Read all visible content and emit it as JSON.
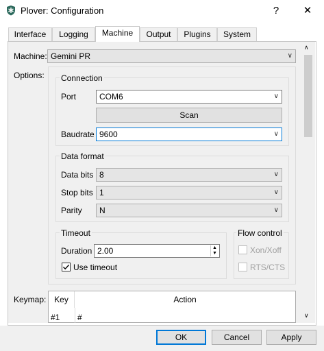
{
  "window": {
    "title": "Plover: Configuration",
    "help_label": "?",
    "close_label": "✕"
  },
  "tabs": [
    {
      "label": "Interface"
    },
    {
      "label": "Logging"
    },
    {
      "label": "Machine"
    },
    {
      "label": "Output"
    },
    {
      "label": "Plugins"
    },
    {
      "label": "System"
    }
  ],
  "active_tab": "Machine",
  "machine": {
    "label": "Machine:",
    "value": "Gemini PR"
  },
  "options_label": "Options:",
  "connection": {
    "title": "Connection",
    "port_label": "Port",
    "port_value": "COM6",
    "scan_label": "Scan",
    "baudrate_label": "Baudrate",
    "baudrate_value": "9600"
  },
  "data_format": {
    "title": "Data format",
    "data_bits_label": "Data bits",
    "data_bits_value": "8",
    "stop_bits_label": "Stop bits",
    "stop_bits_value": "1",
    "parity_label": "Parity",
    "parity_value": "N"
  },
  "timeout": {
    "title": "Timeout",
    "duration_label": "Duration",
    "duration_value": "2.00",
    "use_timeout_label": "Use timeout",
    "use_timeout_checked": true
  },
  "flow_control": {
    "title": "Flow control",
    "xonxoff_label": "Xon/Xoff",
    "rtscts_label": "RTS/CTS"
  },
  "keymap": {
    "label": "Keymap:",
    "headers": [
      "Key",
      "Action"
    ],
    "rows": [
      {
        "key": "#1",
        "action": "#"
      }
    ]
  },
  "buttons": {
    "ok": "OK",
    "cancel": "Cancel",
    "apply": "Apply"
  },
  "colors": {
    "accent": "#0078d7",
    "window_bg": "#f0f0f0"
  }
}
